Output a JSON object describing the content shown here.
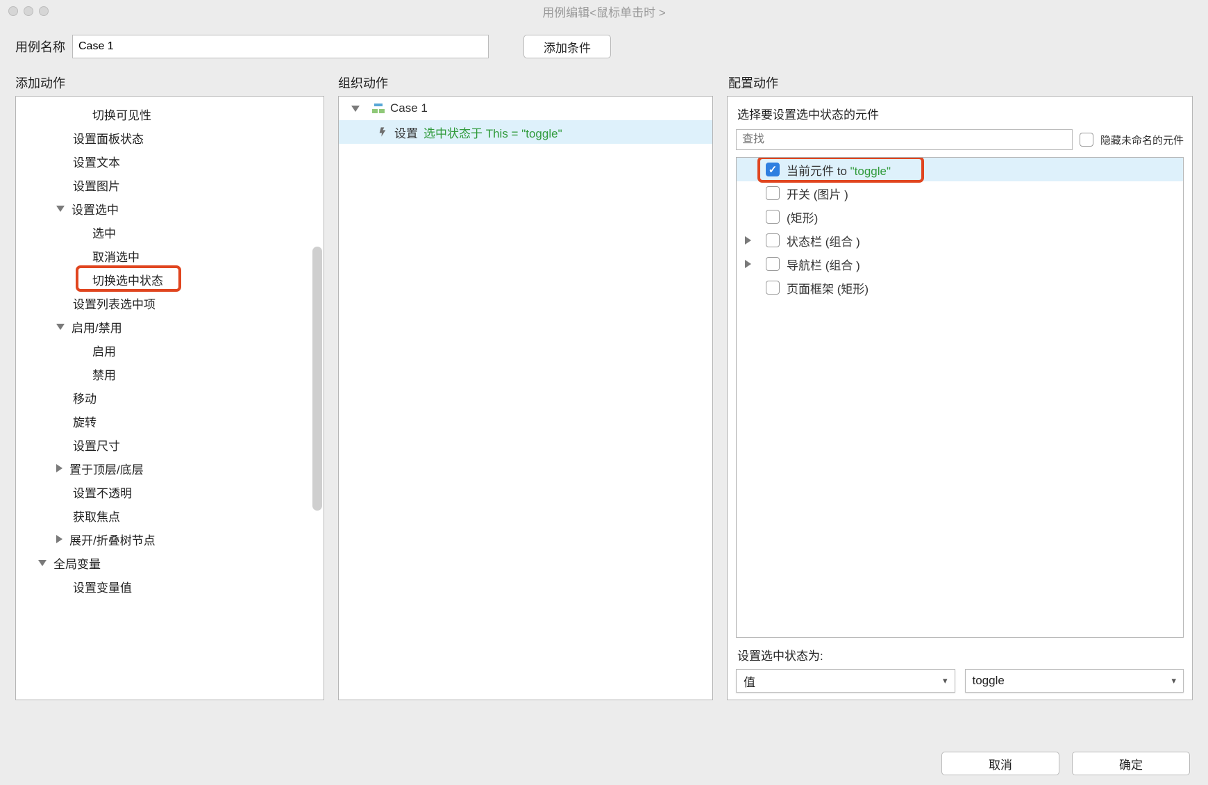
{
  "window": {
    "title": "用例编辑<鼠标单击时 >"
  },
  "topbar": {
    "case_name_label": "用例名称",
    "case_name_value": "Case 1",
    "add_condition_btn": "添加条件"
  },
  "col_heads": {
    "add_action": "添加动作",
    "organize_action": "组织动作",
    "configure_action": "配置动作"
  },
  "action_tree": [
    {
      "indent": 3,
      "label": "切换可见性"
    },
    {
      "indent": 2,
      "label": "设置面板状态"
    },
    {
      "indent": 2,
      "label": "设置文本"
    },
    {
      "indent": 2,
      "label": "设置图片"
    },
    {
      "indent": 2,
      "label": "设置选中",
      "exp": "open"
    },
    {
      "indent": 3,
      "label": "选中"
    },
    {
      "indent": 3,
      "label": "取消选中"
    },
    {
      "indent": 3,
      "label": "切换选中状态",
      "highlight": true
    },
    {
      "indent": 2,
      "label": "设置列表选中项"
    },
    {
      "indent": 2,
      "label": "启用/禁用",
      "exp": "open"
    },
    {
      "indent": 3,
      "label": "启用"
    },
    {
      "indent": 3,
      "label": "禁用"
    },
    {
      "indent": 2,
      "label": "移动"
    },
    {
      "indent": 2,
      "label": "旋转"
    },
    {
      "indent": 2,
      "label": "设置尺寸"
    },
    {
      "indent": 2,
      "label": "置于顶层/底层",
      "exp": "closed"
    },
    {
      "indent": 2,
      "label": "设置不透明"
    },
    {
      "indent": 2,
      "label": "获取焦点"
    },
    {
      "indent": 2,
      "label": "展开/折叠树节点",
      "exp": "closed"
    },
    {
      "indent": 1,
      "label": "全局变量",
      "exp": "open"
    },
    {
      "indent": 2,
      "label": "设置变量值"
    }
  ],
  "organize": {
    "case_label": "Case 1",
    "action_prefix": "设置",
    "action_suffix": "选中状态于 This = \"toggle\""
  },
  "config": {
    "select_widget_label": "选择要设置选中状态的元件",
    "search_placeholder": "查找",
    "hide_unnamed_label": "隐藏未命名的元件",
    "widgets": [
      {
        "indent": 0,
        "checked": true,
        "label_pre": "当前元件 to ",
        "label_q": "\"toggle\"",
        "selected": true,
        "highlight": true
      },
      {
        "indent": 0,
        "checked": false,
        "label": "开关 (图片 )"
      },
      {
        "indent": 0,
        "checked": false,
        "label": "(矩形)"
      },
      {
        "indent": 0,
        "checked": false,
        "label": "状态栏 (组合 )",
        "exp": "closed"
      },
      {
        "indent": 0,
        "checked": false,
        "label": "导航栏 (组合 )",
        "exp": "closed"
      },
      {
        "indent": 0,
        "checked": false,
        "label": "页面框架 (矩形)"
      }
    ],
    "set_state_label": "设置选中状态为:",
    "value_dropdown": "值",
    "toggle_dropdown": "toggle"
  },
  "footer": {
    "cancel": "取消",
    "ok": "确定"
  }
}
